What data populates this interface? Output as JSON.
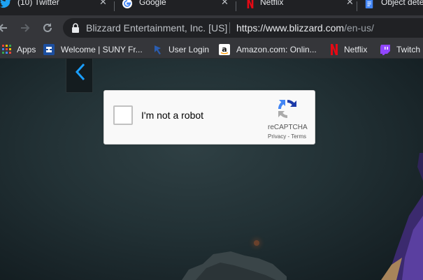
{
  "tabs": [
    {
      "title": "(10) Twitter",
      "icon": "twitter-icon"
    },
    {
      "title": "Google",
      "icon": "google-icon"
    },
    {
      "title": "Netflix",
      "icon": "netflix-icon"
    },
    {
      "title": "Object dete",
      "icon": "docs-icon"
    }
  ],
  "tab_close_glyph": "✕",
  "toolbar": {
    "back": "🡐",
    "forward": "🡒",
    "reload": "⟳",
    "site_identity": "Blizzard Entertainment, Inc. [US]",
    "url_host": "https://www.blizzard.com",
    "url_path": "/en-us/"
  },
  "bookmarks": [
    {
      "label": "Apps",
      "icon": "apps-icon"
    },
    {
      "label": "Welcome | SUNY Fr...",
      "icon": "suny-icon"
    },
    {
      "label": "User Login",
      "icon": "user-login-icon"
    },
    {
      "label": "Amazon.com: Onlin...",
      "icon": "amazon-icon"
    },
    {
      "label": "Netflix",
      "icon": "netflix-icon"
    },
    {
      "label": "Twitch",
      "icon": "twitch-icon"
    }
  ],
  "captcha": {
    "label": "I'm not a robot",
    "brand": "reCAPTCHA",
    "privacy": "Privacy",
    "separator": " - ",
    "terms": "Terms",
    "checked": false
  },
  "colors": {
    "tab_strip": "#202124",
    "toolbar": "#35363a",
    "omnibox": "#202124",
    "captcha_bg": "#f9f9f9",
    "carousel_arrow": "#1a9fff"
  }
}
